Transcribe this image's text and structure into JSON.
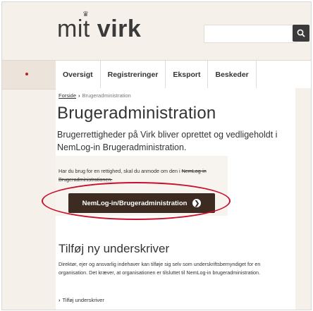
{
  "header": {
    "logo_prefix": "mit",
    "logo_brand": "virk",
    "search_placeholder": ""
  },
  "nav": {
    "items": [
      "Oversigt",
      "Registreringer",
      "Eksport",
      "Beskeder"
    ]
  },
  "breadcrumb": {
    "home": "Forside",
    "current": "Brugeradministration"
  },
  "page": {
    "title": "Brugeradministration",
    "lead": "Brugerrettigheder på Virk bliver oprettet og vedligeholdt i NemLog-in Brugeradministration."
  },
  "info": {
    "text_part1": "Har du brug for en rettighed, skal du anmode om den i ",
    "text_part2": "NemLog-in Brugeradministrationen.",
    "button_label": "NemLog-in/Brugeradministration"
  },
  "section": {
    "title": "Tilføj ny underskriver",
    "text": "Direktør, ejer og ansvarlig indehaver kan tilføje sig selv som underskriftsbemyndiget for en organisation. Det kræver, at organisationen er tilsluttet til NemLog-in brugeradministration.",
    "link_label": "Tilføj underskriver"
  },
  "colors": {
    "accent": "#3d2b22",
    "highlight": "#c8102e"
  },
  "icons": [
    "crown-icon",
    "search-icon",
    "arrow-right-icon",
    "chevron-right-icon"
  ]
}
